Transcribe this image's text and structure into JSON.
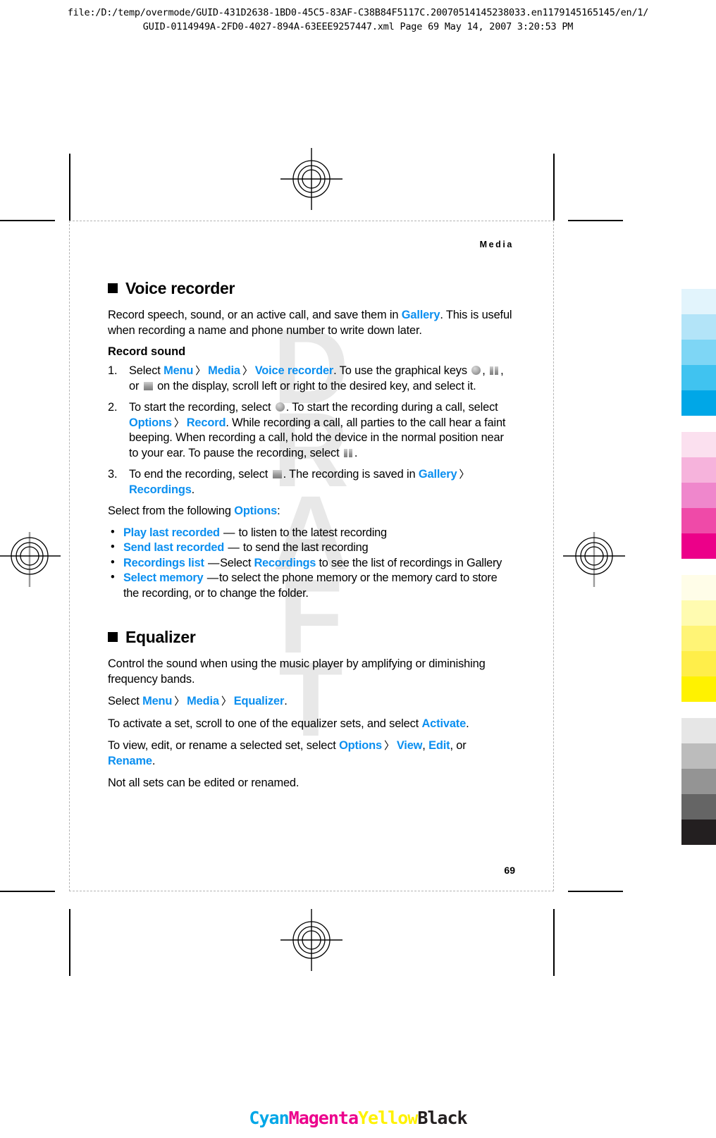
{
  "print_header": {
    "line1": "file:/D:/temp/overmode/GUID-431D2638-1BD0-45C5-83AF-C38B84F5117C.20070514145238033.en1179145165145/en/1/",
    "line2": "GUID-0114949A-2FD0-4027-894A-63EEE9257447.xml     Page 69    May 14, 2007 3:20:53 PM"
  },
  "watermark": {
    "line1": "D",
    "line2": "R",
    "line3": "A",
    "line4": "F",
    "line5": "T"
  },
  "page": {
    "running_head": "Media",
    "folio": "69"
  },
  "voice_recorder": {
    "heading": "Voice recorder",
    "intro_a": "Record speech, sound, or an active call, and save them in ",
    "intro_link": "Gallery",
    "intro_b": ". This is useful when recording a name and phone number to write down later.",
    "subheading": "Record sound",
    "steps": [
      {
        "num": "1.",
        "t1": "Select ",
        "l1": "Menu",
        "c1": "〉",
        "l2": "Media",
        "c2": "〉",
        "l3": "Voice recorder",
        "t2": ". To use the graphical keys ",
        "icon1": "record-key-icon",
        "t3": ", ",
        "icon2": "pause-key-icon",
        "t4": ", or ",
        "icon3": "stop-key-icon",
        "t5": " on the display, scroll left or right to the desired key, and select it."
      },
      {
        "num": "2.",
        "t1": "To start the recording, select ",
        "icon1": "record-key-icon",
        "t2": ". To start the recording during a call, select ",
        "l1": "Options",
        "c1": "〉",
        "l2": "Record",
        "t3": ". While recording a call, all parties to the call hear a faint beeping. When recording a call, hold the device in the normal position near to your ear. To pause the recording, select ",
        "icon2": "pause-key-icon",
        "t4": "."
      },
      {
        "num": "3.",
        "t1": "To end the recording, select ",
        "icon1": "stop-key-icon",
        "t2": ". The recording is saved in ",
        "l1": "Gallery",
        "c1": "〉",
        "l2": "Recordings",
        "t3": "."
      }
    ],
    "options_lead_a": "Select from the following ",
    "options_lead_link": "Options",
    "options_lead_b": ":",
    "bullets": [
      {
        "term": "Play last recorded",
        "dash": "—",
        "desc": " to listen to the latest recording"
      },
      {
        "term": "Send last recorded",
        "dash": "—",
        "desc": " to send the last recording"
      },
      {
        "term": "Recordings list",
        "dash": "—",
        "desc_a": "Select ",
        "desc_link": "Recordings",
        "desc_b": " to see the list of recordings in Gallery"
      },
      {
        "term": "Select memory",
        "dash": "—",
        "desc": "to select the phone memory or the memory card to store the recording, or to change the folder."
      }
    ]
  },
  "equalizer": {
    "heading": "Equalizer",
    "intro": "Control the sound when using the music player by amplifying or diminishing frequency bands.",
    "path_lead": "Select ",
    "path_l1": "Menu",
    "path_c1": "〉",
    "path_l2": "Media",
    "path_c2": "〉",
    "path_l3": "Equalizer",
    "path_end": ".",
    "activate_a": "To activate a set, scroll to one of the equalizer sets, and select ",
    "activate_link": "Activate",
    "activate_b": ".",
    "view_a": "To view, edit, or rename a selected set, select ",
    "view_l1": "Options",
    "view_c1": "〉",
    "view_l2": "View",
    "view_sep1": ", ",
    "view_l3": "Edit",
    "view_sep2": ", or ",
    "view_l4": "Rename",
    "view_b": ".",
    "note": "Not all sets can be edited or renamed."
  },
  "cmyk_legend": {
    "cyan": "Cyan",
    "magenta": "Magenta",
    "yellow": "Yellow",
    "black": "Black"
  },
  "colors": {
    "link_blue": "#0b8ff0",
    "cyan": "#00a7e7",
    "magenta": "#ec008c",
    "yellow": "#fff200",
    "black": "#231f20",
    "cyan_ramp": [
      "#e2f4fc",
      "#b3e4f8",
      "#7ed6f5",
      "#40c3f0",
      "#00a7e7"
    ],
    "magenta_ramp": [
      "#fbe0ef",
      "#f6b3dc",
      "#ef87cc",
      "#ef4aa8",
      "#ec0089"
    ],
    "yellow_ramp": [
      "#fffde8",
      "#fffbb0",
      "#fff476",
      "#ffee4a",
      "#fff200"
    ],
    "black_ramp": [
      "#e6e6e6",
      "#bcbcbc",
      "#949494",
      "#656565",
      "#231f20"
    ]
  }
}
